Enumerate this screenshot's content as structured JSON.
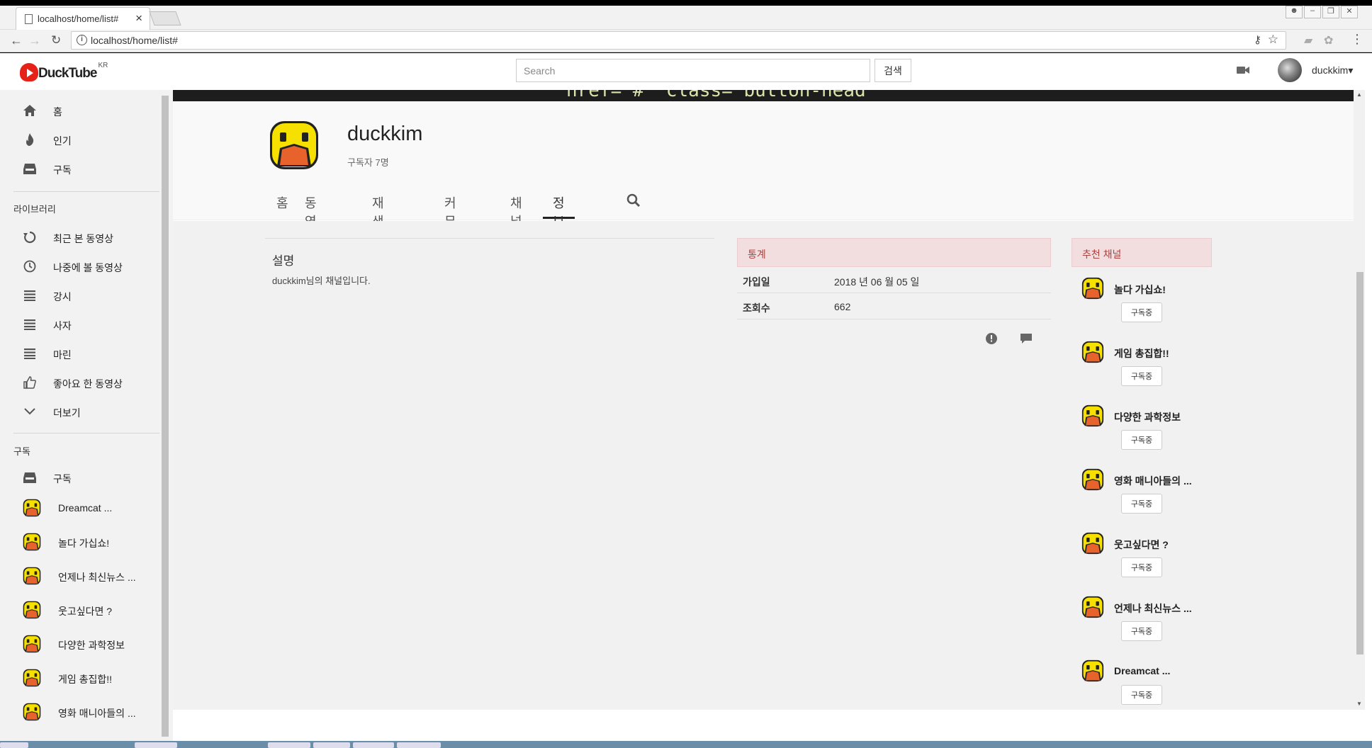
{
  "browser": {
    "tab_title": "localhost/home/list#",
    "tab_close": "×",
    "url": "localhost/home/list#"
  },
  "header": {
    "brand": "DuckTube",
    "brand_suffix": "KR",
    "search_placeholder": "Search",
    "search_button": "검색",
    "username": "duckkim"
  },
  "sidebar": {
    "main_items": [
      {
        "label": "홈",
        "icon": "home-icon"
      },
      {
        "label": "인기",
        "icon": "fire-icon"
      },
      {
        "label": "구독",
        "icon": "inbox-icon"
      }
    ],
    "library_heading": "라이브러리",
    "library_items": [
      {
        "label": "최근 본 동영상",
        "icon": "history-icon"
      },
      {
        "label": "나중에 볼 동영상",
        "icon": "clock-icon"
      },
      {
        "label": "강시",
        "icon": "list-icon"
      },
      {
        "label": "사자",
        "icon": "list-icon"
      },
      {
        "label": "마린",
        "icon": "list-icon"
      },
      {
        "label": "좋아요 한 동영상",
        "icon": "thumbs-up-icon"
      },
      {
        "label": "더보기",
        "icon": "chevron-down-icon"
      }
    ],
    "subs_heading": "구독",
    "subs_all": "구독",
    "subscriptions": [
      "Dreamcat ...",
      "놀다 가십쇼!",
      "언제나 최신뉴스 ...",
      "웃고싶다면 ?",
      "다양한 과학정보",
      "게임 총집합!!",
      "영화 매니아들의 ..."
    ]
  },
  "channel": {
    "banner_code": "href=\"#\" class=\"button-head",
    "name": "duckkim",
    "subscribers": "구독자 7명",
    "tabs": [
      "홈",
      "동영상",
      "재생목록",
      "커뮤니티",
      "채널",
      "정보"
    ],
    "active_tab": "정보"
  },
  "about": {
    "desc_title": "설명",
    "desc_text": "duckkim님의 채널입니다."
  },
  "stats": {
    "heading": "통계",
    "rows": [
      {
        "key": "가입일",
        "value": "2018 년 06 월 05 일"
      },
      {
        "key": "조회수",
        "value": "662"
      }
    ]
  },
  "recommended": {
    "heading": "추천 채널",
    "button_label": "구독중",
    "channels": [
      "놀다 가십쇼!",
      "게임 총집합!!",
      "다양한 과학정보",
      "영화 매니아들의 ...",
      "웃고싶다면 ?",
      "언제나 최신뉴스 ...",
      "Dreamcat ..."
    ]
  },
  "colors": {
    "panel_head_bg": "#f2dede",
    "panel_head_text": "#a94442",
    "brand_red": "#e62117",
    "duck_yellow": "#f5e000",
    "duck_beak": "#e8622c"
  }
}
